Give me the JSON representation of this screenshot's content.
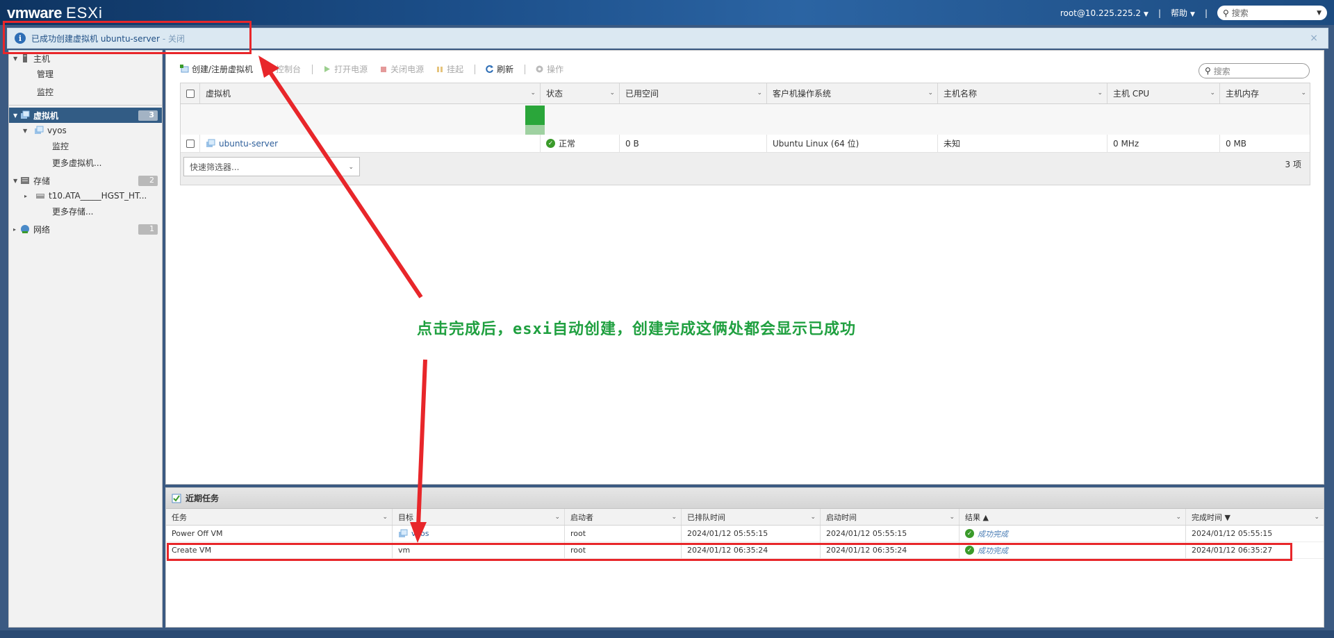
{
  "header": {
    "brand": "vmware",
    "product": "ESXi",
    "user": "root@10.225.225.2",
    "help": "帮助",
    "search_placeholder": "搜索"
  },
  "notification": {
    "message": "已成功创建虚拟机 ubuntu-server",
    "close_link": "- 关闭",
    "close_glyph": "×"
  },
  "sidebar": {
    "host": {
      "label": "主机",
      "children": [
        "管理",
        "监控"
      ]
    },
    "vms": {
      "label": "虚拟机",
      "count": "3",
      "children": [
        {
          "label": "vyos",
          "children": [
            "监控"
          ]
        },
        {
          "label": "更多虚拟机..."
        }
      ]
    },
    "storage": {
      "label": "存储",
      "count": "2",
      "children": [
        {
          "label": "t10.ATA_____HGST_HT..."
        },
        {
          "label": "更多存储..."
        }
      ]
    },
    "network": {
      "label": "网络",
      "count": "1"
    }
  },
  "toolbar": {
    "create": "创建/注册虚拟机",
    "console": "控制台",
    "power_on": "打开电源",
    "power_off": "关闭电源",
    "suspend": "挂起",
    "refresh": "刷新",
    "actions": "操作",
    "search_placeholder": "搜索"
  },
  "vm_grid": {
    "columns": [
      "虚拟机",
      "状态",
      "已用空间",
      "客户机操作系统",
      "主机名称",
      "主机 CPU",
      "主机内存"
    ],
    "rows": [
      {
        "name": "ubuntu-server",
        "status": "正常",
        "used": "0 B",
        "os": "Ubuntu Linux (64 位)",
        "hostname": "未知",
        "cpu": "0 MHz",
        "memory": "0 MB"
      }
    ],
    "quick_filter": "快速筛选器...",
    "count": "3 项"
  },
  "annotation": "点击完成后，esxi自动创建，创建完成这俩处都会显示已成功",
  "tasks": {
    "title": "近期任务",
    "columns": [
      "任务",
      "目标",
      "启动者",
      "已排队时间",
      "启动时间",
      "结果 ▲",
      "完成时间 ▼"
    ],
    "rows": [
      {
        "task": "Power Off VM",
        "target": "vyos",
        "initiator": "root",
        "queued": "2024/01/12 05:55:15",
        "started": "2024/01/12 05:55:15",
        "result": "成功完成",
        "completed": "2024/01/12 05:55:15"
      },
      {
        "task": "Create VM",
        "target": "vm",
        "initiator": "root",
        "queued": "2024/01/12 06:35:24",
        "started": "2024/01/12 06:35:24",
        "result": "成功完成",
        "completed": "2024/01/12 06:35:27"
      }
    ]
  },
  "colors": {
    "header": "#1c4f8a",
    "annotation": "#20a040",
    "highlight": "#e8262a",
    "status_ok": "#3a9a2a"
  }
}
